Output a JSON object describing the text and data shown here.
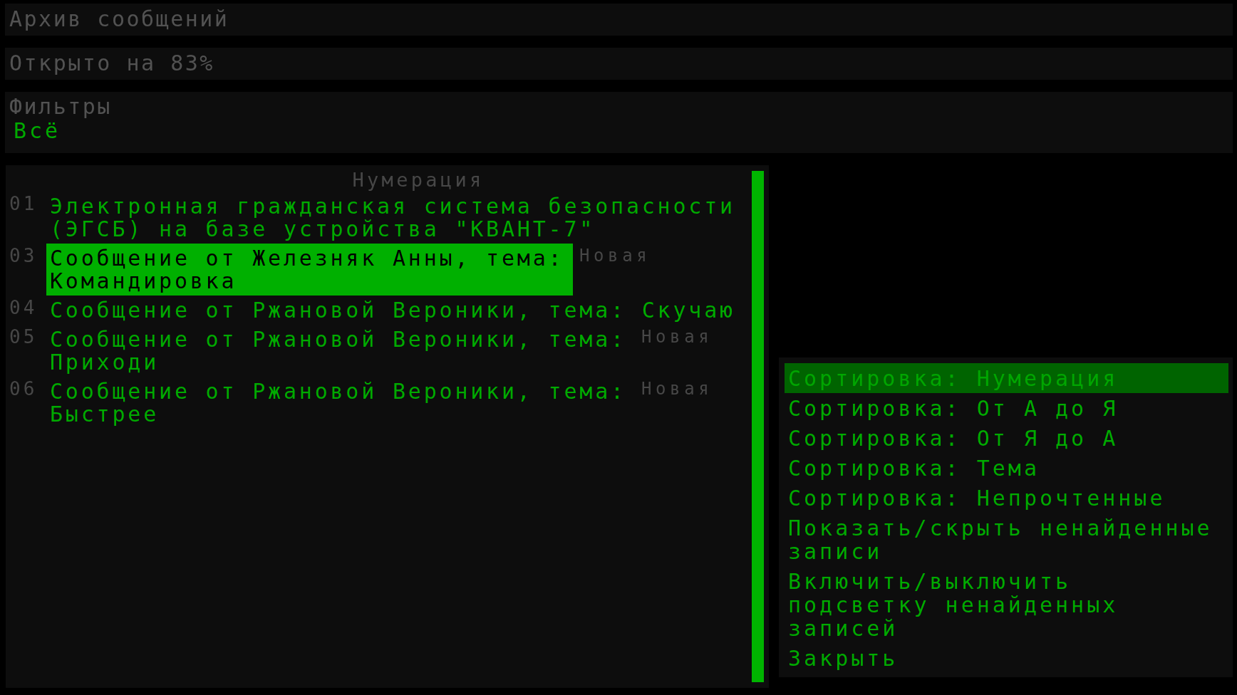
{
  "window": {
    "title": "Архив сообщений"
  },
  "status": {
    "text": "Открыто на 83%"
  },
  "filters": {
    "label": "Фильтры",
    "value": "Всё"
  },
  "message_list": {
    "header": "Нумерация",
    "rows": [
      {
        "number": "01",
        "text": "Электронная гражданская система безопасности (ЭГСБ) на базе устройства \"КВАНТ-7\"",
        "selected": false
      },
      {
        "number": "03",
        "text": "Сообщение от Железняк Анны, тема: Командировка",
        "tag": "Новая",
        "selected": true
      },
      {
        "number": "04",
        "text": "Сообщение от Ржановой Вероники, тема: Скучаю",
        "selected": false
      },
      {
        "number": "05",
        "text": "Сообщение от Ржановой Вероники, тема: Приходи",
        "tag": "Новая",
        "selected": false
      },
      {
        "number": "06",
        "text": "Сообщение от Ржановой Вероники, тема: Быстрее",
        "tag": "Новая",
        "selected": false
      }
    ]
  },
  "menu": {
    "items": [
      {
        "label": "Сортировка: Нумерация",
        "selected": true
      },
      {
        "label": "Сортировка: От А до Я",
        "selected": false
      },
      {
        "label": "Сортировка: От Я до А",
        "selected": false
      },
      {
        "label": "Сортировка: Тема",
        "selected": false
      },
      {
        "label": "Сортировка: Непрочтенные",
        "selected": false
      },
      {
        "label": "Показать/скрыть ненайденные записи",
        "selected": false
      },
      {
        "label": "Включить/выключить подсветку ненайденных записей",
        "selected": false
      },
      {
        "label": "Закрыть",
        "selected": false
      }
    ]
  }
}
